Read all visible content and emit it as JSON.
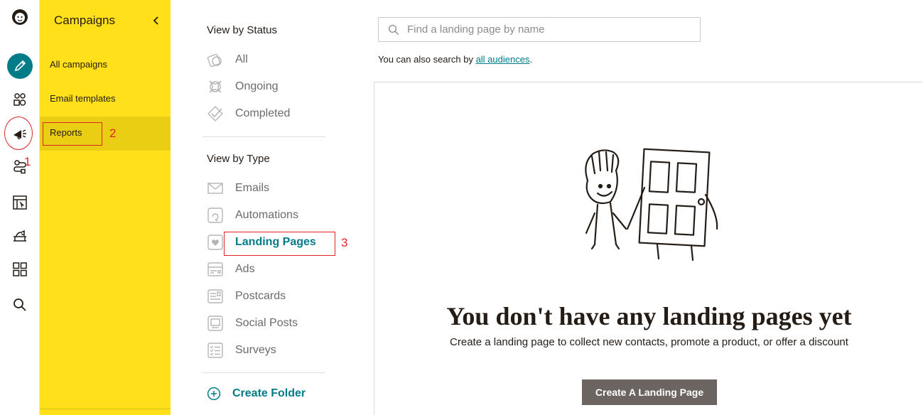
{
  "app": {
    "brand": "Mailchimp"
  },
  "rail": {
    "items": [
      {
        "name": "create",
        "icon": "pencil-icon"
      },
      {
        "name": "audience",
        "icon": "audience-icon"
      },
      {
        "name": "campaigns",
        "icon": "megaphone-icon"
      },
      {
        "name": "automations",
        "icon": "automations-icon"
      },
      {
        "name": "website",
        "icon": "website-icon"
      },
      {
        "name": "content-studio",
        "icon": "content-icon"
      },
      {
        "name": "integrations",
        "icon": "grid-icon"
      },
      {
        "name": "search",
        "icon": "search-icon"
      }
    ]
  },
  "campaign_panel": {
    "title": "Campaigns",
    "items": [
      {
        "label": "All campaigns"
      },
      {
        "label": "Email templates"
      },
      {
        "label": "Reports"
      }
    ]
  },
  "status_filter": {
    "title": "View by Status",
    "items": [
      {
        "label": "All"
      },
      {
        "label": "Ongoing"
      },
      {
        "label": "Completed"
      }
    ]
  },
  "type_filter": {
    "title": "View by Type",
    "items": [
      {
        "label": "Emails"
      },
      {
        "label": "Automations"
      },
      {
        "label": "Landing Pages"
      },
      {
        "label": "Ads"
      },
      {
        "label": "Postcards"
      },
      {
        "label": "Social Posts"
      },
      {
        "label": "Surveys"
      }
    ],
    "active": "Landing Pages"
  },
  "create_folder": {
    "label": "Create Folder"
  },
  "search": {
    "placeholder": "Find a landing page by name",
    "hint_prefix": "You can also search by ",
    "hint_link": "all audiences",
    "hint_suffix": "."
  },
  "empty_state": {
    "title": "You don't have any landing pages yet",
    "description": "Create a landing page to collect new contacts, promote a product, or offer a discount",
    "button": "Create A Landing Page"
  },
  "annotations": {
    "one": "1",
    "two": "2",
    "three": "3"
  },
  "colors": {
    "brand_yellow": "#ffe01b",
    "active_yellow": "#eace13",
    "teal": "#007c89",
    "annotation_red": "#e0242a",
    "button_gray": "#6b6461"
  }
}
